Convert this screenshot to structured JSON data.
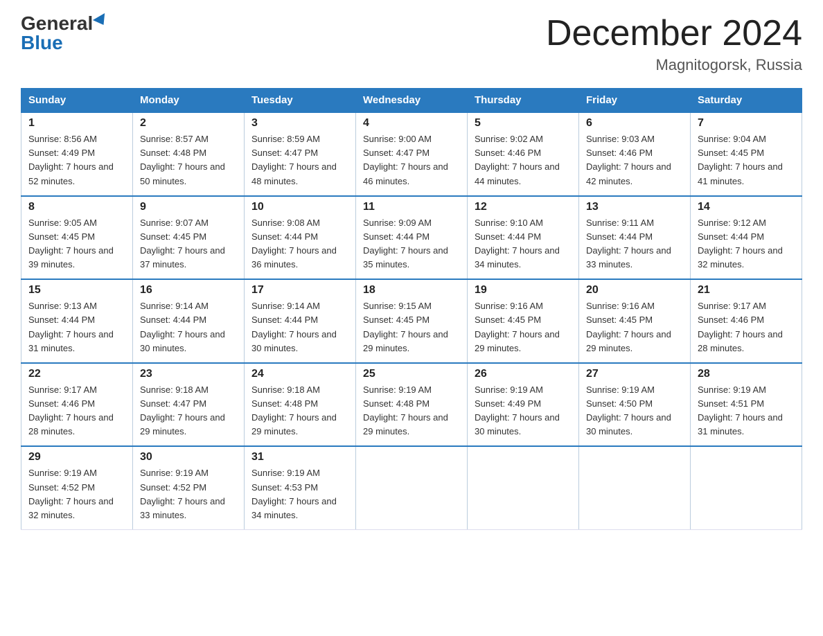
{
  "header": {
    "logo_general": "General",
    "logo_blue": "Blue",
    "month_title": "December 2024",
    "location": "Magnitogorsk, Russia"
  },
  "days_of_week": [
    "Sunday",
    "Monday",
    "Tuesday",
    "Wednesday",
    "Thursday",
    "Friday",
    "Saturday"
  ],
  "weeks": [
    [
      {
        "day": "1",
        "sunrise": "Sunrise: 8:56 AM",
        "sunset": "Sunset: 4:49 PM",
        "daylight": "Daylight: 7 hours and 52 minutes."
      },
      {
        "day": "2",
        "sunrise": "Sunrise: 8:57 AM",
        "sunset": "Sunset: 4:48 PM",
        "daylight": "Daylight: 7 hours and 50 minutes."
      },
      {
        "day": "3",
        "sunrise": "Sunrise: 8:59 AM",
        "sunset": "Sunset: 4:47 PM",
        "daylight": "Daylight: 7 hours and 48 minutes."
      },
      {
        "day": "4",
        "sunrise": "Sunrise: 9:00 AM",
        "sunset": "Sunset: 4:47 PM",
        "daylight": "Daylight: 7 hours and 46 minutes."
      },
      {
        "day": "5",
        "sunrise": "Sunrise: 9:02 AM",
        "sunset": "Sunset: 4:46 PM",
        "daylight": "Daylight: 7 hours and 44 minutes."
      },
      {
        "day": "6",
        "sunrise": "Sunrise: 9:03 AM",
        "sunset": "Sunset: 4:46 PM",
        "daylight": "Daylight: 7 hours and 42 minutes."
      },
      {
        "day": "7",
        "sunrise": "Sunrise: 9:04 AM",
        "sunset": "Sunset: 4:45 PM",
        "daylight": "Daylight: 7 hours and 41 minutes."
      }
    ],
    [
      {
        "day": "8",
        "sunrise": "Sunrise: 9:05 AM",
        "sunset": "Sunset: 4:45 PM",
        "daylight": "Daylight: 7 hours and 39 minutes."
      },
      {
        "day": "9",
        "sunrise": "Sunrise: 9:07 AM",
        "sunset": "Sunset: 4:45 PM",
        "daylight": "Daylight: 7 hours and 37 minutes."
      },
      {
        "day": "10",
        "sunrise": "Sunrise: 9:08 AM",
        "sunset": "Sunset: 4:44 PM",
        "daylight": "Daylight: 7 hours and 36 minutes."
      },
      {
        "day": "11",
        "sunrise": "Sunrise: 9:09 AM",
        "sunset": "Sunset: 4:44 PM",
        "daylight": "Daylight: 7 hours and 35 minutes."
      },
      {
        "day": "12",
        "sunrise": "Sunrise: 9:10 AM",
        "sunset": "Sunset: 4:44 PM",
        "daylight": "Daylight: 7 hours and 34 minutes."
      },
      {
        "day": "13",
        "sunrise": "Sunrise: 9:11 AM",
        "sunset": "Sunset: 4:44 PM",
        "daylight": "Daylight: 7 hours and 33 minutes."
      },
      {
        "day": "14",
        "sunrise": "Sunrise: 9:12 AM",
        "sunset": "Sunset: 4:44 PM",
        "daylight": "Daylight: 7 hours and 32 minutes."
      }
    ],
    [
      {
        "day": "15",
        "sunrise": "Sunrise: 9:13 AM",
        "sunset": "Sunset: 4:44 PM",
        "daylight": "Daylight: 7 hours and 31 minutes."
      },
      {
        "day": "16",
        "sunrise": "Sunrise: 9:14 AM",
        "sunset": "Sunset: 4:44 PM",
        "daylight": "Daylight: 7 hours and 30 minutes."
      },
      {
        "day": "17",
        "sunrise": "Sunrise: 9:14 AM",
        "sunset": "Sunset: 4:44 PM",
        "daylight": "Daylight: 7 hours and 30 minutes."
      },
      {
        "day": "18",
        "sunrise": "Sunrise: 9:15 AM",
        "sunset": "Sunset: 4:45 PM",
        "daylight": "Daylight: 7 hours and 29 minutes."
      },
      {
        "day": "19",
        "sunrise": "Sunrise: 9:16 AM",
        "sunset": "Sunset: 4:45 PM",
        "daylight": "Daylight: 7 hours and 29 minutes."
      },
      {
        "day": "20",
        "sunrise": "Sunrise: 9:16 AM",
        "sunset": "Sunset: 4:45 PM",
        "daylight": "Daylight: 7 hours and 29 minutes."
      },
      {
        "day": "21",
        "sunrise": "Sunrise: 9:17 AM",
        "sunset": "Sunset: 4:46 PM",
        "daylight": "Daylight: 7 hours and 28 minutes."
      }
    ],
    [
      {
        "day": "22",
        "sunrise": "Sunrise: 9:17 AM",
        "sunset": "Sunset: 4:46 PM",
        "daylight": "Daylight: 7 hours and 28 minutes."
      },
      {
        "day": "23",
        "sunrise": "Sunrise: 9:18 AM",
        "sunset": "Sunset: 4:47 PM",
        "daylight": "Daylight: 7 hours and 29 minutes."
      },
      {
        "day": "24",
        "sunrise": "Sunrise: 9:18 AM",
        "sunset": "Sunset: 4:48 PM",
        "daylight": "Daylight: 7 hours and 29 minutes."
      },
      {
        "day": "25",
        "sunrise": "Sunrise: 9:19 AM",
        "sunset": "Sunset: 4:48 PM",
        "daylight": "Daylight: 7 hours and 29 minutes."
      },
      {
        "day": "26",
        "sunrise": "Sunrise: 9:19 AM",
        "sunset": "Sunset: 4:49 PM",
        "daylight": "Daylight: 7 hours and 30 minutes."
      },
      {
        "day": "27",
        "sunrise": "Sunrise: 9:19 AM",
        "sunset": "Sunset: 4:50 PM",
        "daylight": "Daylight: 7 hours and 30 minutes."
      },
      {
        "day": "28",
        "sunrise": "Sunrise: 9:19 AM",
        "sunset": "Sunset: 4:51 PM",
        "daylight": "Daylight: 7 hours and 31 minutes."
      }
    ],
    [
      {
        "day": "29",
        "sunrise": "Sunrise: 9:19 AM",
        "sunset": "Sunset: 4:52 PM",
        "daylight": "Daylight: 7 hours and 32 minutes."
      },
      {
        "day": "30",
        "sunrise": "Sunrise: 9:19 AM",
        "sunset": "Sunset: 4:52 PM",
        "daylight": "Daylight: 7 hours and 33 minutes."
      },
      {
        "day": "31",
        "sunrise": "Sunrise: 9:19 AM",
        "sunset": "Sunset: 4:53 PM",
        "daylight": "Daylight: 7 hours and 34 minutes."
      },
      null,
      null,
      null,
      null
    ]
  ]
}
